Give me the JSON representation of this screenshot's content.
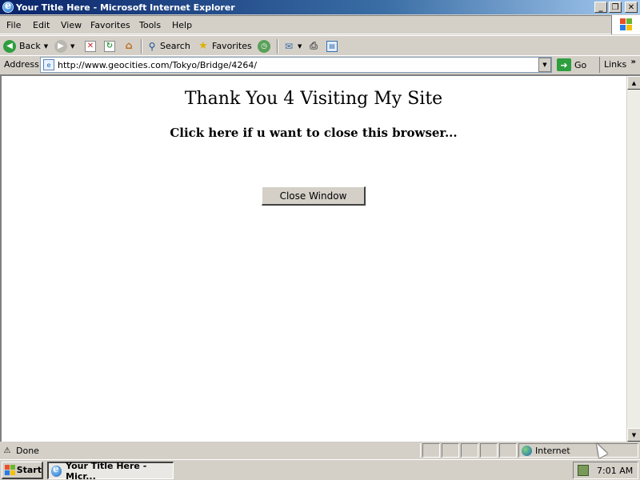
{
  "window": {
    "title": "Your Title Here - Microsoft Internet Explorer",
    "buttons": [
      "_",
      "❐",
      "✕"
    ]
  },
  "menubar": {
    "items": [
      "File",
      "Edit",
      "View",
      "Favorites",
      "Tools",
      "Help"
    ]
  },
  "toolbar": {
    "back_label": "Back",
    "search_label": "Search",
    "favorites_label": "Favorites"
  },
  "address": {
    "label": "Address",
    "url": "http://www.geocities.com/Tokyo/Bridge/4264/",
    "go_label": "Go",
    "links_label": "Links",
    "links_chevron": "»"
  },
  "page": {
    "heading": "Thank You 4 Visiting My Site",
    "subheading": "Click here if u want to close this browser...",
    "close_button_label": "Close Window"
  },
  "statusbar": {
    "status": "Done",
    "zone": "Internet"
  },
  "taskbar": {
    "start_label": "Start",
    "task_label": "Your Title Here - Micr...",
    "clock": "7:01 AM"
  },
  "colors": {
    "titlebar_start": "#0a246a",
    "titlebar_end": "#a6caf0",
    "chrome": "#d4d0c8",
    "content_bg": "#ffffff"
  }
}
